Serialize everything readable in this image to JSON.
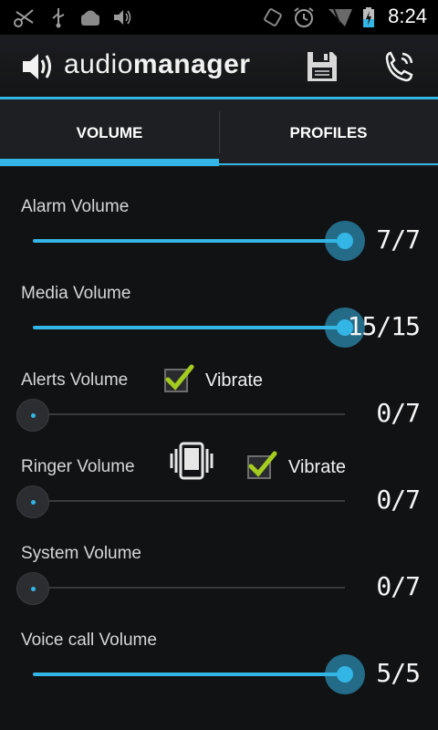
{
  "status_bar": {
    "time": "8:24",
    "icons": [
      "scissors-icon",
      "usb-icon",
      "android-debug-icon",
      "volume-icon",
      "rotate-icon",
      "alarm-icon",
      "signal-icon",
      "battery-charging-icon"
    ]
  },
  "header": {
    "title_light": "audio",
    "title_bold": "manager",
    "actions": [
      "save-icon",
      "phone-settings-icon"
    ]
  },
  "tabs": [
    {
      "label": "VOLUME",
      "active": true
    },
    {
      "label": "PROFILES",
      "active": false
    }
  ],
  "volumes": [
    {
      "label": "Alarm Volume",
      "value": "7/7",
      "level": 1.0
    },
    {
      "label": "Media Volume",
      "value": "15/15",
      "level": 1.0
    },
    {
      "label": "Alerts Volume",
      "value": "0/7",
      "level": 0.0,
      "vibrate_label": "Vibrate",
      "vibrate_checked": true
    },
    {
      "label": "Ringer Volume",
      "value": "0/7",
      "level": 0.0,
      "vibrate_label": "Vibrate",
      "vibrate_checked": true
    },
    {
      "label": "System Volume",
      "value": "0/7",
      "level": 0.0
    },
    {
      "label": "Voice call Volume",
      "value": "5/5",
      "level": 1.0
    }
  ],
  "colors": {
    "accent": "#33b5e5",
    "background": "#111214",
    "check": "#a4cc1f"
  }
}
